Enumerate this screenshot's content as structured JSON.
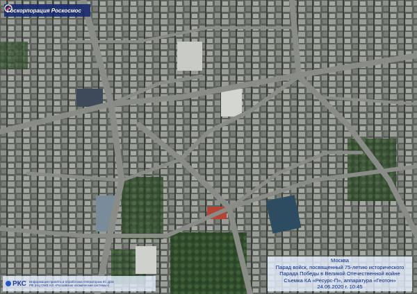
{
  "logo_top": {
    "text": "Госкорпорация Роскосмос",
    "icon": "roscosmos-logo-icon"
  },
  "caption": {
    "city": "Москва",
    "line1": "Парад войск, посвященный 75-летию исторического",
    "line2": "Парада Победы в Великой Отечественной войне",
    "line3": "Съемка КА «Ресурс-П», аппаратура «Геотон»",
    "date": "24.06.2020 г. 10:45"
  },
  "footer": {
    "brand": "РКС",
    "line1": "Информация принята и обработана Оператором КС ДЗЗ",
    "line2": "РФ (НЦ ОМЗ АО «Российские космические системы»)"
  },
  "colors": {
    "caption_text": "#0a2a8a",
    "logo_bg": "#14286e",
    "brand": "#1b3c9a"
  }
}
